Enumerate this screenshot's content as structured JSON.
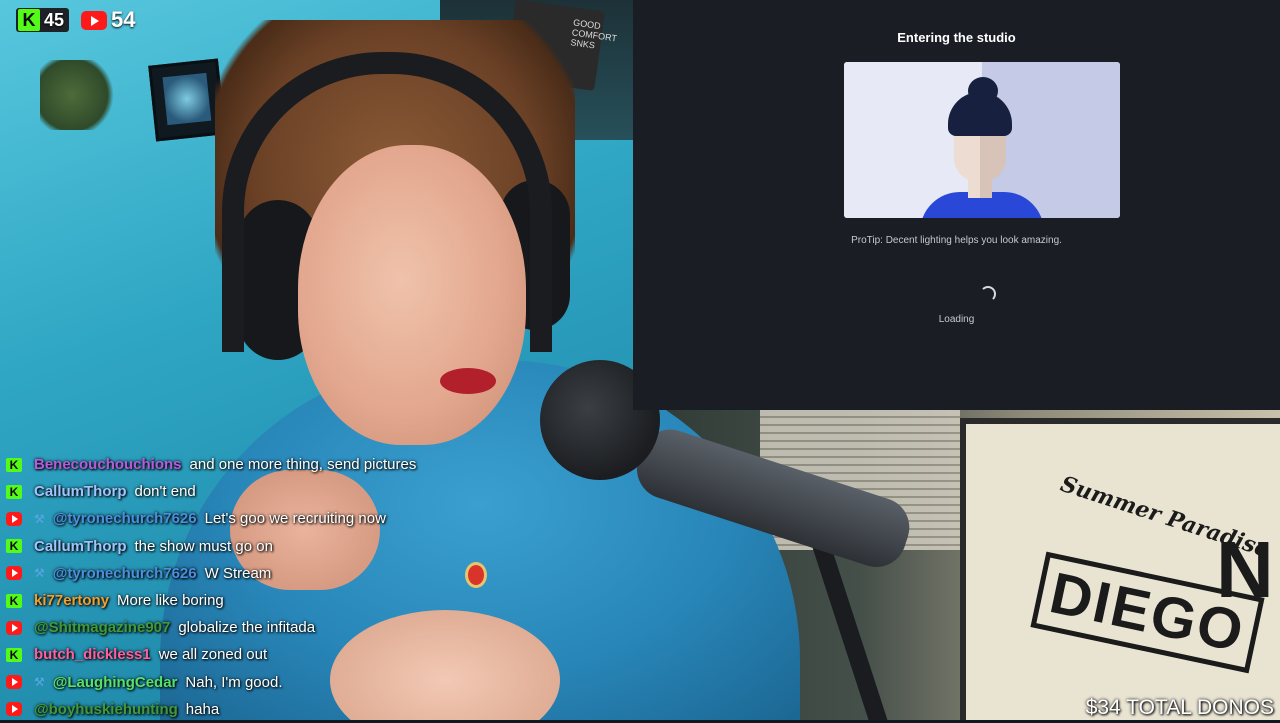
{
  "counters": {
    "kick_logo_text": "K",
    "kick_count": "45",
    "youtube_count": "54"
  },
  "studio": {
    "title": "Entering the studio",
    "protip": "ProTip: Decent lighting helps you look amazing.",
    "loading_label": "Loading"
  },
  "chat": {
    "messages": [
      {
        "platform": "kick",
        "mod": false,
        "user": "Benecouchouchions",
        "user_color": "#b55be0",
        "text": "and one more thing, send pictures"
      },
      {
        "platform": "kick",
        "mod": false,
        "user": "CallumThorp",
        "user_color": "#9fc5ff",
        "text": "don't end"
      },
      {
        "platform": "youtube",
        "mod": true,
        "user": "@tyronechurch7626",
        "user_color": "#4a8fe0",
        "text": "Let's goo we recruiting now"
      },
      {
        "platform": "kick",
        "mod": false,
        "user": "CallumThorp",
        "user_color": "#9fc5ff",
        "text": "the show must go on"
      },
      {
        "platform": "youtube",
        "mod": true,
        "user": "@tyronechurch7626",
        "user_color": "#4a8fe0",
        "text": "W Stream"
      },
      {
        "platform": "kick",
        "mod": false,
        "user": "ki77ertony",
        "user_color": "#f0a030",
        "text": "More like boring"
      },
      {
        "platform": "youtube",
        "mod": false,
        "user": "@Shitmagazine907",
        "user_color": "#3f9b3a",
        "text": "globalize the infitada"
      },
      {
        "platform": "kick",
        "mod": false,
        "user": "butch_dickless1",
        "user_color": "#ff5fa0",
        "text": "we all zoned out"
      },
      {
        "platform": "youtube",
        "mod": true,
        "user": "@LaughingCedar",
        "user_color": "#56e26a",
        "text": "Nah, I'm good."
      },
      {
        "platform": "youtube",
        "mod": false,
        "user": "@boyhuskiehunting",
        "user_color": "#3f9b3a",
        "text": "haha"
      }
    ]
  },
  "donations": {
    "total_label": "$34 TOTAL DONOS"
  },
  "background_poster_text": {
    "word": "DIEGO",
    "letter": "N",
    "script": "Summer Paradise"
  },
  "shelf_box_text": "GOOD COMFORT SNKS",
  "colors": {
    "kick_green": "#53fc18",
    "youtube_red": "#ff1a1a",
    "studio_bg": "#1b1d24",
    "avatar_shirt": "#2a48d8"
  },
  "icons": {
    "kick": "kick-logo-icon",
    "youtube": "youtube-logo-icon",
    "moderator": "wrench-icon",
    "spinner": "loading-spinner-icon"
  }
}
